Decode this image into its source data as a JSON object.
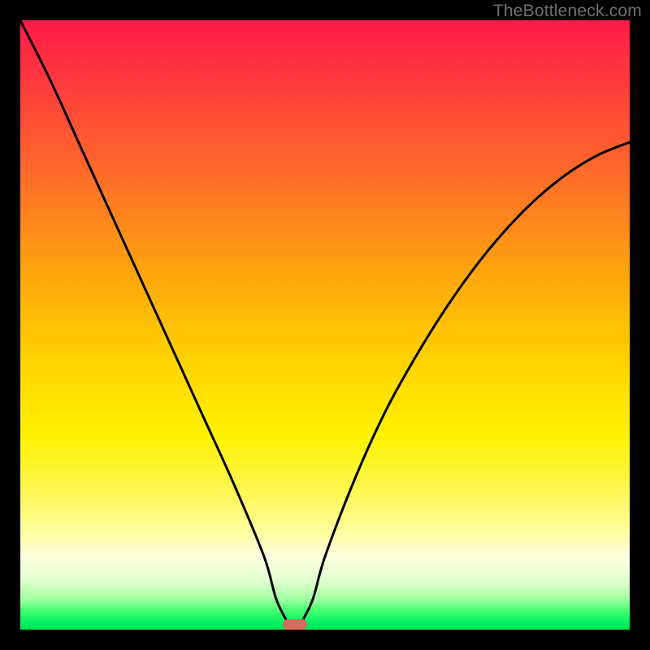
{
  "watermark": "TheBottleneck.com",
  "chart_data": {
    "type": "line",
    "title": "",
    "xlabel": "",
    "ylabel": "",
    "xlim": [
      0,
      100
    ],
    "ylim": [
      0,
      100
    ],
    "series": [
      {
        "name": "bottleneck-curve",
        "x": [
          0,
          5,
          10,
          15,
          20,
          25,
          30,
          35,
          40,
          42,
          44,
          45,
          46,
          48,
          50,
          55,
          60,
          65,
          70,
          75,
          80,
          85,
          90,
          95,
          100
        ],
        "values": [
          100,
          90,
          79,
          68,
          57,
          46,
          35,
          24,
          12,
          5,
          1,
          0,
          1,
          5,
          12,
          25,
          36,
          45,
          53,
          60,
          66,
          71,
          75,
          78,
          80
        ]
      }
    ],
    "marker": {
      "x": 45,
      "y": 0
    },
    "gradient_stops": [
      {
        "pos": 0,
        "color": "#ff1a4a"
      },
      {
        "pos": 55,
        "color": "#ffd000"
      },
      {
        "pos": 88,
        "color": "#ffffe0"
      },
      {
        "pos": 100,
        "color": "#00e050"
      }
    ]
  }
}
